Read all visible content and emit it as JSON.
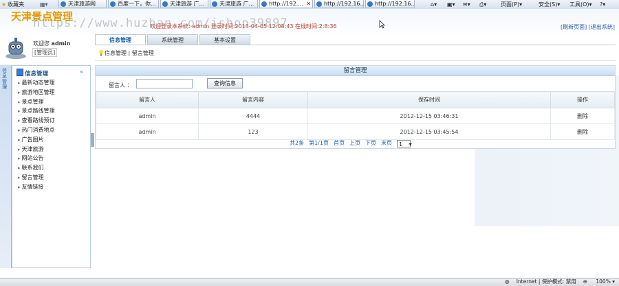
{
  "browser": {
    "favorites_label": "收藏夹",
    "tabs": [
      {
        "label": "天津旅游网",
        "active": false
      },
      {
        "label": "百度一下，你...",
        "active": false
      },
      {
        "label": "天津旅游 广...",
        "active": false
      },
      {
        "label": "天津旅游 广...",
        "active": false
      },
      {
        "label": "http://192....",
        "active": true
      },
      {
        "label": "http://192.16...",
        "active": false
      },
      {
        "label": "http://192.16...",
        "active": false
      }
    ],
    "commands": {
      "page": "页面(P)",
      "safety": "安全(S)",
      "tools": "工具(O)"
    },
    "status": {
      "zone": "Internet | 保护模式: 禁用",
      "zoom": "100%"
    }
  },
  "app": {
    "title": "天津景点管理",
    "welcome_line": "欢迎登录本系统: admin   登录时间:2013-04-05 12:08:43   在线时间:2:8:36",
    "top_links": "[刷新页面] [退出系统]",
    "watermark": "https://www.huzhan.com/ishop39897"
  },
  "user": {
    "greeting": "欢迎您",
    "name": "admin",
    "role": "[管理员]"
  },
  "top_tabs": [
    "信息管理",
    "系统管理",
    "基本设置"
  ],
  "breadcrumb": [
    "信息管理",
    "留言管理"
  ],
  "sidebar": {
    "strip_label": "信息管理",
    "heading": "信息管理",
    "collapse_icon": "«",
    "items": [
      "最新动态管理",
      "旅游地区管理",
      "景点管理",
      "景点路线管理",
      "查看路线预订",
      "热门消费地点",
      "广告图片",
      "天津旅游",
      "网站公告",
      "联系我们",
      "留言管理",
      "友情链接"
    ]
  },
  "panel": {
    "title": "留言管理",
    "query_label": "留言人 ：",
    "query_value": "",
    "query_button": "查询信息",
    "columns": [
      "留言人",
      "留言内容",
      "保存时间",
      "操作"
    ],
    "rows": [
      {
        "author": "admin",
        "content": "4444",
        "time": "2012-12-15 03:46:31",
        "action": "删除"
      },
      {
        "author": "admin",
        "content": "123",
        "time": "2012-12-15 03:45:54",
        "action": "删除"
      }
    ],
    "pager": {
      "total": "共2条",
      "page_info": "第1/1页",
      "first": "首页",
      "prev": "上页",
      "next": "下页",
      "last": "末页",
      "selected": "1"
    }
  }
}
